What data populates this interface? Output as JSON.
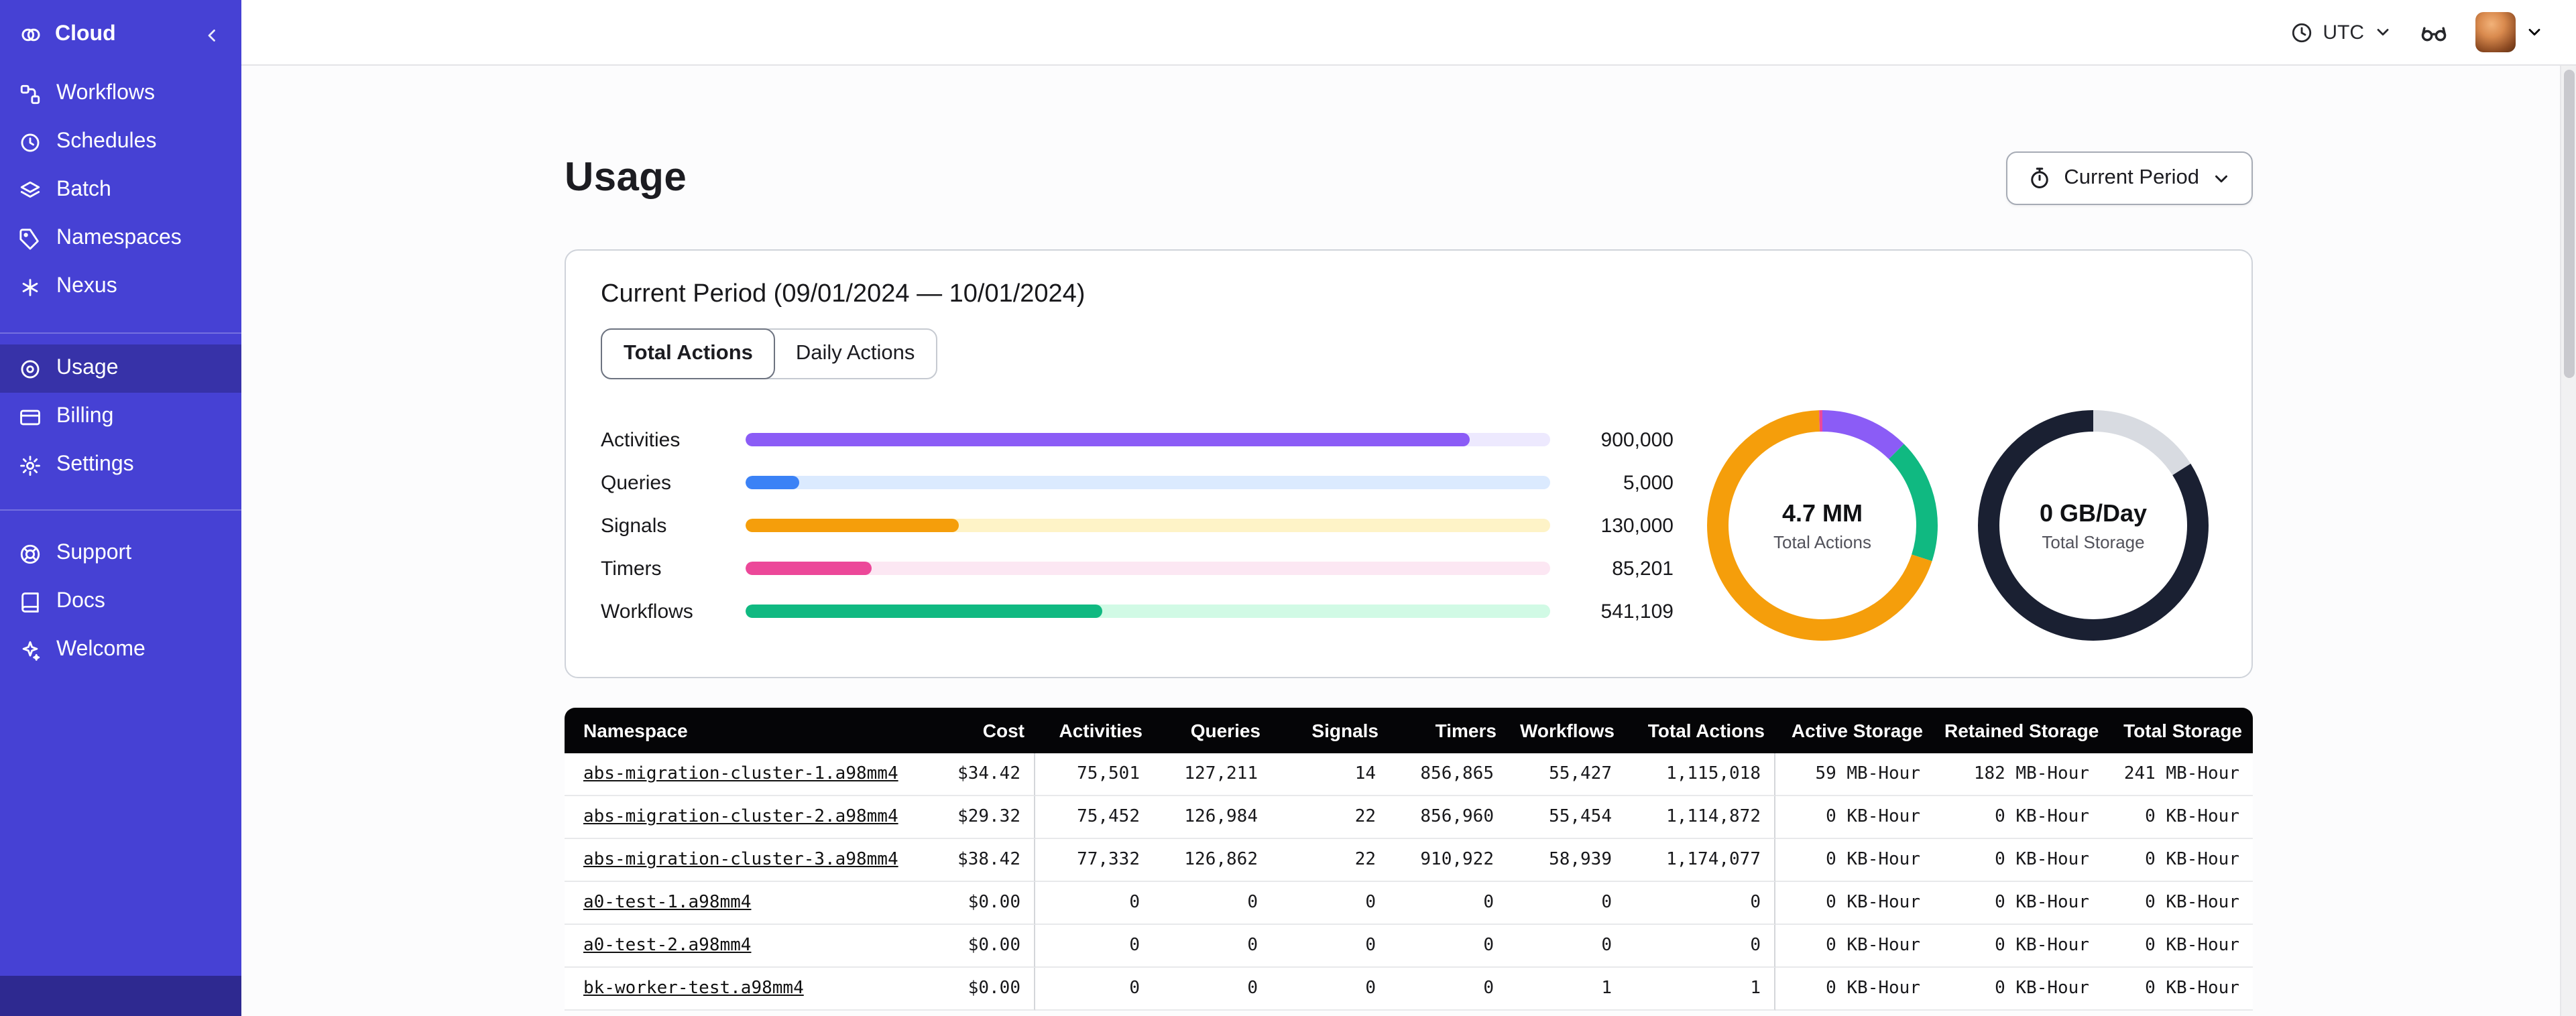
{
  "sidebar": {
    "brand_label": "Cloud",
    "groups": [
      {
        "items": [
          {
            "label": "Workflows"
          },
          {
            "label": "Schedules"
          },
          {
            "label": "Batch"
          },
          {
            "label": "Namespaces"
          },
          {
            "label": "Nexus"
          }
        ]
      },
      {
        "items": [
          {
            "label": "Usage",
            "selected": true
          },
          {
            "label": "Billing"
          },
          {
            "label": "Settings"
          }
        ]
      },
      {
        "items": [
          {
            "label": "Support"
          },
          {
            "label": "Docs"
          },
          {
            "label": "Welcome"
          }
        ]
      }
    ]
  },
  "topbar": {
    "timezone": "UTC"
  },
  "page": {
    "title": "Usage",
    "period_selector_label": "Current Period"
  },
  "usage_card": {
    "title": "Current Period (09/01/2024 — 10/01/2024)",
    "tabs": [
      {
        "label": "Total Actions",
        "active": true
      },
      {
        "label": "Daily Actions",
        "active": false
      }
    ]
  },
  "chart_data": [
    {
      "type": "bar",
      "orientation": "horizontal",
      "categories": [
        "Activities",
        "Queries",
        "Signals",
        "Timers",
        "Workflows"
      ],
      "values": [
        900000,
        5000,
        130000,
        85201,
        541109
      ],
      "value_labels": [
        "900,000",
        "5,000",
        "130,000",
        "85,201",
        "541,109"
      ],
      "bar_fractions": [
        0.9,
        0.067,
        0.265,
        0.157,
        0.443
      ],
      "colors": [
        "#8b5cf6",
        "#3b82f6",
        "#f59e0b",
        "#ec4899",
        "#10b981"
      ],
      "track_colors": [
        "#ede9fe",
        "#dbeafe",
        "#fef3c7",
        "#fce7f3",
        "#d1fae5"
      ],
      "title": "",
      "xlabel": "",
      "ylabel": ""
    },
    {
      "type": "pie",
      "title": "Total Actions",
      "center_value": "4.7 MM",
      "donut": true,
      "slices": [
        {
          "fraction": 0.125,
          "color": "#8b5cf6"
        },
        {
          "fraction": 0.175,
          "color": "#10b981"
        },
        {
          "fraction": 0.695,
          "color": "#f59e0b"
        },
        {
          "fraction": 0.005,
          "color": "#ec4899"
        }
      ]
    },
    {
      "type": "pie",
      "title": "Total Storage",
      "center_value": "0 GB/Day",
      "donut": true,
      "slices": [
        {
          "fraction": 0.16,
          "color": "#d8dbe1"
        },
        {
          "fraction": 0.84,
          "color": "#1a2032"
        }
      ]
    }
  ],
  "table": {
    "columns": [
      "Namespace",
      "Cost",
      "Activities",
      "Queries",
      "Signals",
      "Timers",
      "Workflows",
      "Total Actions",
      "Active Storage",
      "Retained Storage",
      "Total Storage"
    ],
    "rows": [
      [
        "abs-migration-cluster-1.a98mm4",
        "$34.42",
        "75,501",
        "127,211",
        "14",
        "856,865",
        "55,427",
        "1,115,018",
        "59 MB-Hour",
        "182 MB-Hour",
        "241 MB-Hour"
      ],
      [
        "abs-migration-cluster-2.a98mm4",
        "$29.32",
        "75,452",
        "126,984",
        "22",
        "856,960",
        "55,454",
        "1,114,872",
        "0 KB-Hour",
        "0 KB-Hour",
        "0 KB-Hour"
      ],
      [
        "abs-migration-cluster-3.a98mm4",
        "$38.42",
        "77,332",
        "126,862",
        "22",
        "910,922",
        "58,939",
        "1,174,077",
        "0 KB-Hour",
        "0 KB-Hour",
        "0 KB-Hour"
      ],
      [
        "a0-test-1.a98mm4",
        "$0.00",
        "0",
        "0",
        "0",
        "0",
        "0",
        "0",
        "0 KB-Hour",
        "0 KB-Hour",
        "0 KB-Hour"
      ],
      [
        "a0-test-2.a98mm4",
        "$0.00",
        "0",
        "0",
        "0",
        "0",
        "0",
        "0",
        "0 KB-Hour",
        "0 KB-Hour",
        "0 KB-Hour"
      ],
      [
        "bk-worker-test.a98mm4",
        "$0.00",
        "0",
        "0",
        "0",
        "0",
        "1",
        "1",
        "0 KB-Hour",
        "0 KB-Hour",
        "0 KB-Hour"
      ]
    ]
  }
}
